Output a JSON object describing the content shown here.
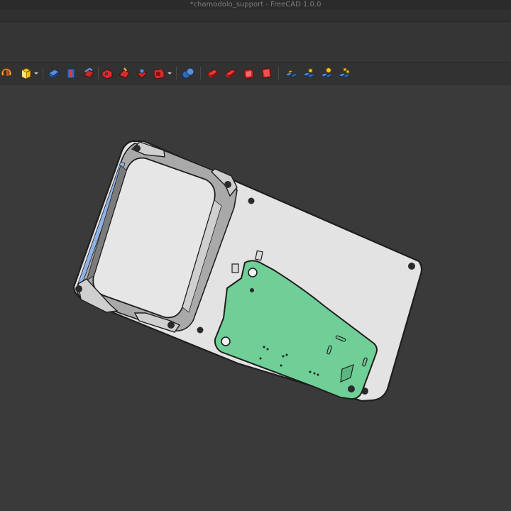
{
  "window": {
    "title": "*chamodolo_support - FreeCAD 1.0.0"
  },
  "toolbar": {
    "icons": [
      "revolve-icon",
      "pad-icon",
      "dropdown-arrow-icon",
      "additive-box-icon",
      "additive-cylinder-icon",
      "additive-helix-icon",
      "pocket-icon",
      "groove-icon",
      "subtractive-shape-icon",
      "hole-icon",
      "dropdown-arrow-icon",
      "boolean-icon",
      "fillet-icon",
      "chamfer-icon",
      "draft-icon",
      "thickness-icon",
      "mirrored-icon",
      "linear-pattern-icon",
      "polar-pattern-icon",
      "multi-transform-icon"
    ]
  },
  "colors": {
    "background": "#3a3a3a",
    "plate": "#e3e3e3",
    "pcb": "#6fcf97",
    "toolbar": "#323232"
  }
}
